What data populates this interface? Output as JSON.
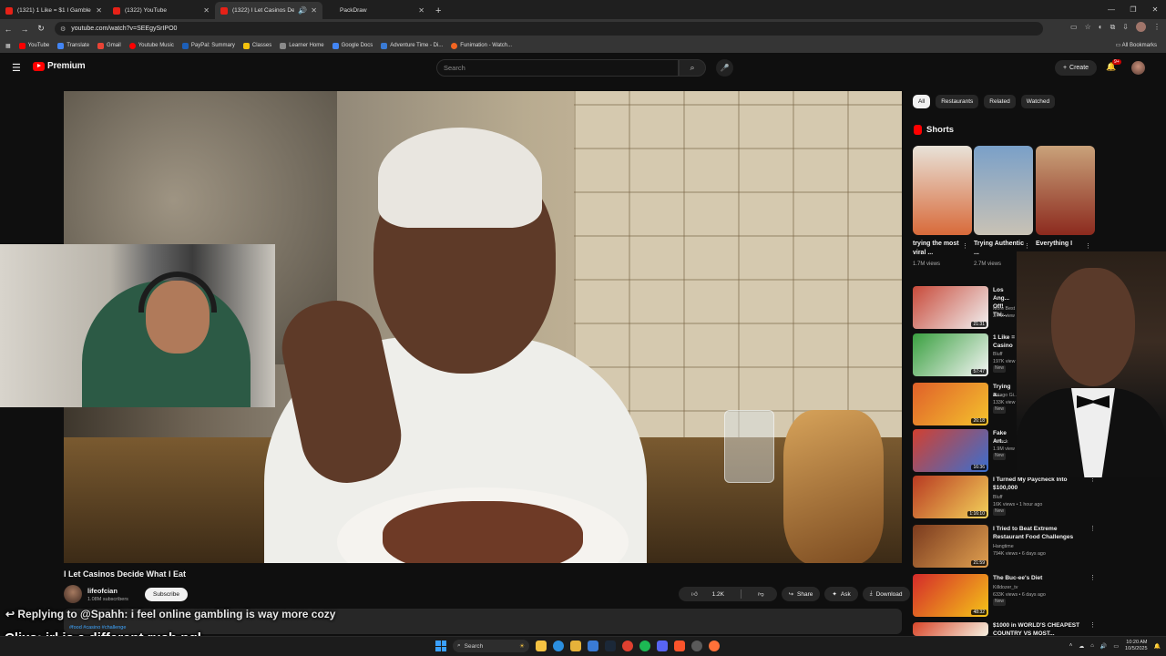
{
  "browser": {
    "tabs": [
      {
        "label": "(1321) 1 Like = $1 I Gamble at t",
        "active": false,
        "favicon": "youtube-icon"
      },
      {
        "label": "(1322) YouTube",
        "active": false,
        "favicon": "youtube-icon"
      },
      {
        "label": "(1322) I Let Casinos Decide",
        "active": true,
        "favicon": "youtube-icon"
      },
      {
        "label": "PackDraw",
        "active": false,
        "favicon": "packdraw-icon"
      }
    ],
    "url": "youtube.com/watch?v=SEEgySrIPO0",
    "bookmarks": [
      {
        "label": "YouTube",
        "color": "#ff0000"
      },
      {
        "label": "Translate",
        "color": "#4285f4"
      },
      {
        "label": "Gmail",
        "color": "#ea4335"
      },
      {
        "label": "Youtube Music",
        "color": "#ff0000"
      },
      {
        "label": "PayPal: Summary",
        "color": "#1d5fb8"
      },
      {
        "label": "Classes",
        "color": "#f4c20d"
      },
      {
        "label": "Learner Home",
        "color": "#8a8a8a"
      },
      {
        "label": "Google Docs",
        "color": "#4285f4"
      },
      {
        "label": "Adventure Time - Di...",
        "color": "#3a7bd5"
      },
      {
        "label": "Funimation - Watch...",
        "color": "#f26522"
      }
    ],
    "all_bookmarks": "All Bookmarks"
  },
  "youtube": {
    "logo_text": "Premium",
    "search_placeholder": "Search",
    "create_label": "Create",
    "notification_count": "9+",
    "video": {
      "title": "I Let Casinos Decide What I Eat",
      "channel": "lifeofcian",
      "subscribers": "1.08M subscribers",
      "subscribe_label": "Subscribe",
      "likes": "1.2K",
      "share_label": "Share",
      "ask_label": "Ask",
      "download_label": "Download",
      "more_label": "•••",
      "tags": "#food #casino #challenge"
    },
    "chips": [
      {
        "label": "All",
        "active": true
      },
      {
        "label": "Restaurants",
        "active": false
      },
      {
        "label": "Related",
        "active": false
      },
      {
        "label": "Watched",
        "active": false
      }
    ],
    "shorts_heading": "Shorts",
    "shorts": [
      {
        "title": "trying the most viral ...",
        "views": "1.7M views",
        "colors": [
          "#e8e2d8",
          "#d86a3a"
        ]
      },
      {
        "title": "Trying Authentic ...",
        "views": "2.7M views",
        "colors": [
          "#7aa0c8",
          "#c9c2b5"
        ]
      },
      {
        "title": "Everything I",
        "views": "",
        "colors": [
          "#c9a27a",
          "#8c2a1e"
        ]
      }
    ],
    "recommendations": [
      {
        "title": "Los Ang... Off! Thi...",
        "meta1": "More Best",
        "meta2": "3.7M view",
        "duration": "21:31",
        "new": false,
        "colors": [
          "#c84a3a",
          "#f1f1f1"
        ]
      },
      {
        "title": "1 Like = Casino",
        "meta1": "Bluff",
        "meta2": "197K view",
        "duration": "57:47",
        "new": true,
        "colors": [
          "#3aa040",
          "#f5f5f5"
        ]
      },
      {
        "title": "Trying a...",
        "meta1": "Thiago Gi...",
        "meta2": "133K view",
        "duration": "26:18",
        "new": true,
        "colors": [
          "#e0602a",
          "#f4c22d"
        ]
      },
      {
        "title": "Fake Art...",
        "meta1": "Airrack",
        "meta2": "1.9M view",
        "duration": "16:36",
        "new": true,
        "colors": [
          "#d24030",
          "#3a6fd0"
        ]
      },
      {
        "title": "I Turned My Paycheck Into $100,000",
        "meta1": "Bluff",
        "meta2": "16K views • 1 hour ago",
        "duration": "1:16:10",
        "new": true,
        "colors": [
          "#b83a22",
          "#f3d25a"
        ]
      },
      {
        "title": "I Tried to Beat Extreme Restaurant Food Challenges",
        "meta1": "Hangtime",
        "meta2": "794K views • 6 days ago",
        "duration": "21:59",
        "new": false,
        "colors": [
          "#7a3a1e",
          "#e0a050"
        ]
      },
      {
        "title": "The Buc-ee's Diet",
        "meta1": "Killdozer_tv",
        "meta2": "633K views • 6 days ago",
        "duration": "48:32",
        "new": true,
        "colors": [
          "#d42a2a",
          "#f5c518"
        ]
      },
      {
        "title": "$1000 in WORLD'S CHEAPEST COUNTRY VS MOST...",
        "meta1": "",
        "meta2": "",
        "duration": "",
        "new": false,
        "colors": [
          "#d8462a",
          "#f5f0e0"
        ]
      }
    ]
  },
  "overlay": {
    "reply_text": "Replying to @Spahh: i feel online gambling is way more cozy",
    "chat_text": "Clixs: irl is a different rush ngl"
  },
  "taskbar": {
    "search_label": "Search",
    "time": "10:20 AM",
    "date": "10/5/2025",
    "apps": [
      {
        "name": "file-explorer-icon",
        "color": "#f4c242"
      },
      {
        "name": "edge-icon",
        "color": "#2b8fe0"
      },
      {
        "name": "folder-icon",
        "color": "#e6b23a"
      },
      {
        "name": "store-icon",
        "color": "#3a7bd5"
      },
      {
        "name": "steam-icon",
        "color": "#1b2838"
      },
      {
        "name": "chrome-icon",
        "color": "#e04030"
      },
      {
        "name": "spotify-icon",
        "color": "#1db954"
      },
      {
        "name": "discord-icon",
        "color": "#5865f2"
      },
      {
        "name": "brave-icon",
        "color": "#fb542b"
      },
      {
        "name": "obs-icon",
        "color": "#5a5a5a"
      },
      {
        "name": "firefox-icon",
        "color": "#ff7139"
      }
    ]
  }
}
